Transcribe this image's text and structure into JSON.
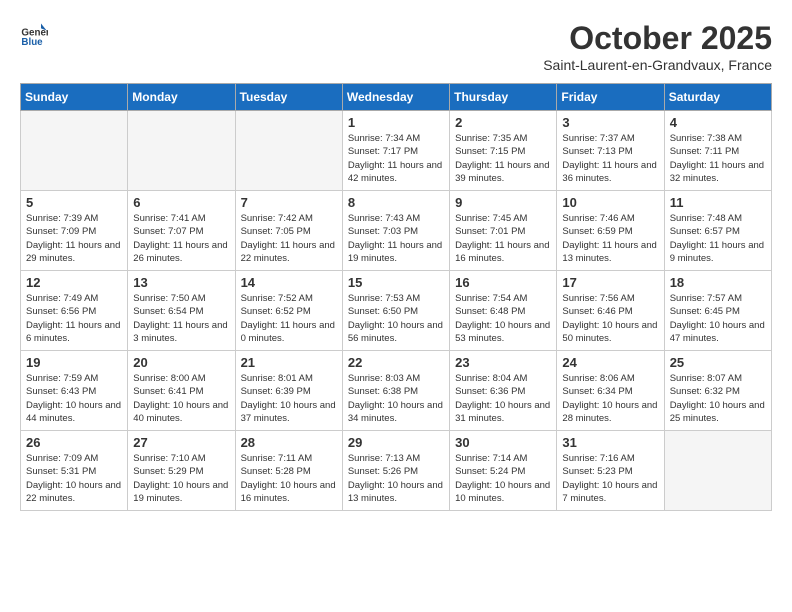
{
  "header": {
    "logo_line1": "General",
    "logo_line2": "Blue",
    "month_title": "October 2025",
    "location": "Saint-Laurent-en-Grandvaux, France"
  },
  "weekdays": [
    "Sunday",
    "Monday",
    "Tuesday",
    "Wednesday",
    "Thursday",
    "Friday",
    "Saturday"
  ],
  "weeks": [
    [
      {
        "day": "",
        "empty": true
      },
      {
        "day": "",
        "empty": true
      },
      {
        "day": "",
        "empty": true
      },
      {
        "day": "1",
        "sunrise": "7:34 AM",
        "sunset": "7:17 PM",
        "daylight": "11 hours and 42 minutes."
      },
      {
        "day": "2",
        "sunrise": "7:35 AM",
        "sunset": "7:15 PM",
        "daylight": "11 hours and 39 minutes."
      },
      {
        "day": "3",
        "sunrise": "7:37 AM",
        "sunset": "7:13 PM",
        "daylight": "11 hours and 36 minutes."
      },
      {
        "day": "4",
        "sunrise": "7:38 AM",
        "sunset": "7:11 PM",
        "daylight": "11 hours and 32 minutes."
      }
    ],
    [
      {
        "day": "5",
        "sunrise": "7:39 AM",
        "sunset": "7:09 PM",
        "daylight": "11 hours and 29 minutes."
      },
      {
        "day": "6",
        "sunrise": "7:41 AM",
        "sunset": "7:07 PM",
        "daylight": "11 hours and 26 minutes."
      },
      {
        "day": "7",
        "sunrise": "7:42 AM",
        "sunset": "7:05 PM",
        "daylight": "11 hours and 22 minutes."
      },
      {
        "day": "8",
        "sunrise": "7:43 AM",
        "sunset": "7:03 PM",
        "daylight": "11 hours and 19 minutes."
      },
      {
        "day": "9",
        "sunrise": "7:45 AM",
        "sunset": "7:01 PM",
        "daylight": "11 hours and 16 minutes."
      },
      {
        "day": "10",
        "sunrise": "7:46 AM",
        "sunset": "6:59 PM",
        "daylight": "11 hours and 13 minutes."
      },
      {
        "day": "11",
        "sunrise": "7:48 AM",
        "sunset": "6:57 PM",
        "daylight": "11 hours and 9 minutes."
      }
    ],
    [
      {
        "day": "12",
        "sunrise": "7:49 AM",
        "sunset": "6:56 PM",
        "daylight": "11 hours and 6 minutes."
      },
      {
        "day": "13",
        "sunrise": "7:50 AM",
        "sunset": "6:54 PM",
        "daylight": "11 hours and 3 minutes."
      },
      {
        "day": "14",
        "sunrise": "7:52 AM",
        "sunset": "6:52 PM",
        "daylight": "11 hours and 0 minutes."
      },
      {
        "day": "15",
        "sunrise": "7:53 AM",
        "sunset": "6:50 PM",
        "daylight": "10 hours and 56 minutes."
      },
      {
        "day": "16",
        "sunrise": "7:54 AM",
        "sunset": "6:48 PM",
        "daylight": "10 hours and 53 minutes."
      },
      {
        "day": "17",
        "sunrise": "7:56 AM",
        "sunset": "6:46 PM",
        "daylight": "10 hours and 50 minutes."
      },
      {
        "day": "18",
        "sunrise": "7:57 AM",
        "sunset": "6:45 PM",
        "daylight": "10 hours and 47 minutes."
      }
    ],
    [
      {
        "day": "19",
        "sunrise": "7:59 AM",
        "sunset": "6:43 PM",
        "daylight": "10 hours and 44 minutes."
      },
      {
        "day": "20",
        "sunrise": "8:00 AM",
        "sunset": "6:41 PM",
        "daylight": "10 hours and 40 minutes."
      },
      {
        "day": "21",
        "sunrise": "8:01 AM",
        "sunset": "6:39 PM",
        "daylight": "10 hours and 37 minutes."
      },
      {
        "day": "22",
        "sunrise": "8:03 AM",
        "sunset": "6:38 PM",
        "daylight": "10 hours and 34 minutes."
      },
      {
        "day": "23",
        "sunrise": "8:04 AM",
        "sunset": "6:36 PM",
        "daylight": "10 hours and 31 minutes."
      },
      {
        "day": "24",
        "sunrise": "8:06 AM",
        "sunset": "6:34 PM",
        "daylight": "10 hours and 28 minutes."
      },
      {
        "day": "25",
        "sunrise": "8:07 AM",
        "sunset": "6:32 PM",
        "daylight": "10 hours and 25 minutes."
      }
    ],
    [
      {
        "day": "26",
        "sunrise": "7:09 AM",
        "sunset": "5:31 PM",
        "daylight": "10 hours and 22 minutes."
      },
      {
        "day": "27",
        "sunrise": "7:10 AM",
        "sunset": "5:29 PM",
        "daylight": "10 hours and 19 minutes."
      },
      {
        "day": "28",
        "sunrise": "7:11 AM",
        "sunset": "5:28 PM",
        "daylight": "10 hours and 16 minutes."
      },
      {
        "day": "29",
        "sunrise": "7:13 AM",
        "sunset": "5:26 PM",
        "daylight": "10 hours and 13 minutes."
      },
      {
        "day": "30",
        "sunrise": "7:14 AM",
        "sunset": "5:24 PM",
        "daylight": "10 hours and 10 minutes."
      },
      {
        "day": "31",
        "sunrise": "7:16 AM",
        "sunset": "5:23 PM",
        "daylight": "10 hours and 7 minutes."
      },
      {
        "day": "",
        "empty": true
      }
    ]
  ]
}
